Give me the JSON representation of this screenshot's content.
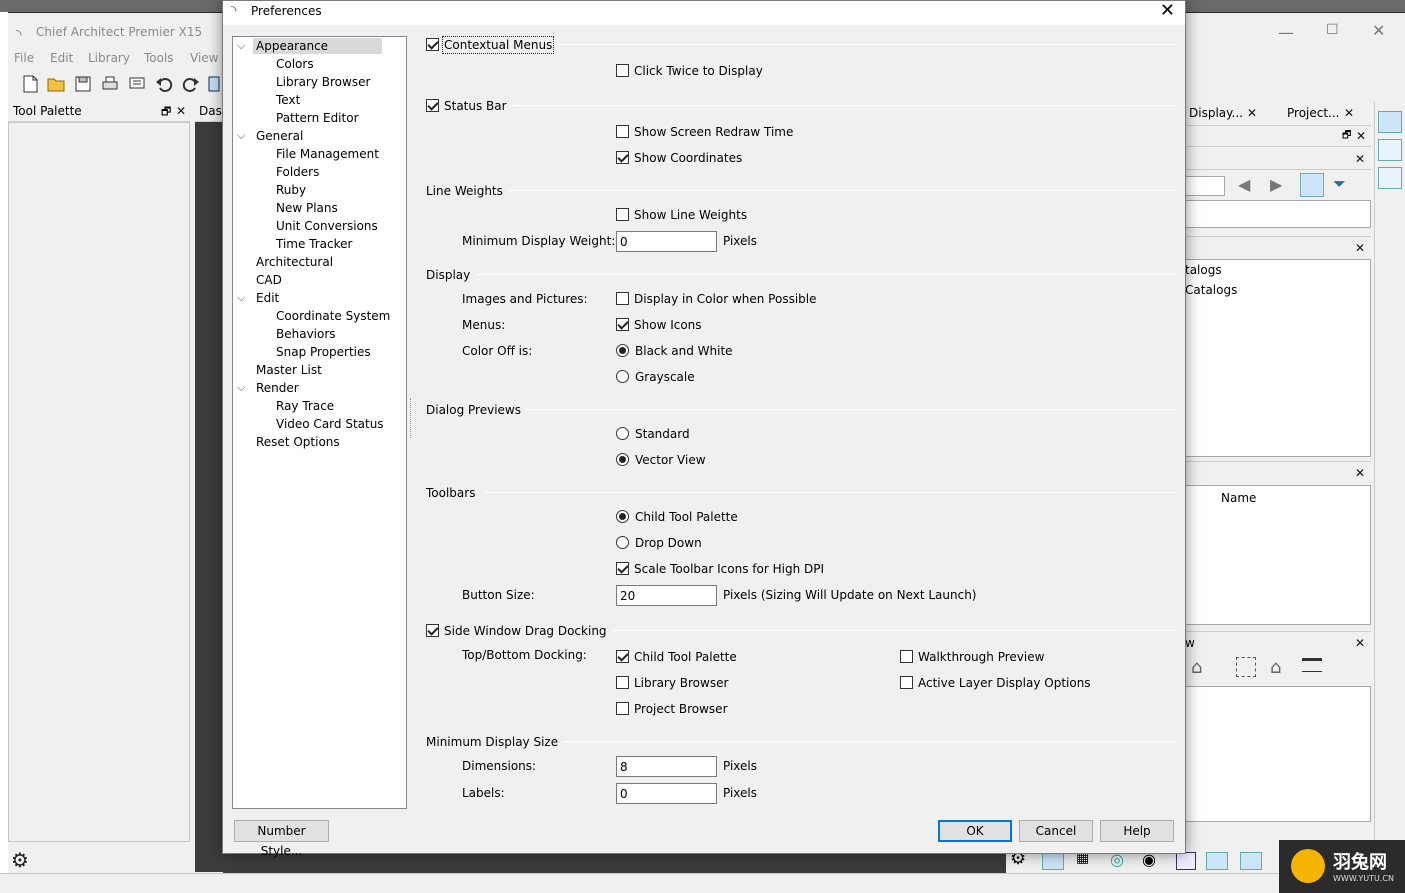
{
  "app": {
    "title": "Chief Architect Premier X15",
    "menu": [
      "File",
      "Edit",
      "Library",
      "Tools",
      "View"
    ],
    "tool_palette_title": "Tool Palette",
    "center_tab": "Das",
    "right_tabs": [
      "Display...",
      "Project..."
    ],
    "catalog_lines": [
      "talogs",
      "Catalogs"
    ],
    "name_column": "Name",
    "partial_label": "w"
  },
  "dialog": {
    "title": "Preferences",
    "tree": [
      {
        "label": "Appearance",
        "level": 0,
        "expanded": true,
        "selected": true
      },
      {
        "label": "Colors",
        "level": 1
      },
      {
        "label": "Library Browser",
        "level": 1
      },
      {
        "label": "Text",
        "level": 1
      },
      {
        "label": "Pattern Editor",
        "level": 1
      },
      {
        "label": "General",
        "level": 0,
        "expanded": true
      },
      {
        "label": "File Management",
        "level": 1
      },
      {
        "label": "Folders",
        "level": 1
      },
      {
        "label": "Ruby",
        "level": 1
      },
      {
        "label": "New Plans",
        "level": 1
      },
      {
        "label": "Unit Conversions",
        "level": 1
      },
      {
        "label": "Time Tracker",
        "level": 1
      },
      {
        "label": "Architectural",
        "level": 0
      },
      {
        "label": "CAD",
        "level": 0
      },
      {
        "label": "Edit",
        "level": 0,
        "expanded": true
      },
      {
        "label": "Coordinate System",
        "level": 1
      },
      {
        "label": "Behaviors",
        "level": 1
      },
      {
        "label": "Snap Properties",
        "level": 1
      },
      {
        "label": "Master List",
        "level": 0
      },
      {
        "label": "Render",
        "level": 0,
        "expanded": true
      },
      {
        "label": "Ray Trace",
        "level": 1
      },
      {
        "label": "Video Card Status",
        "level": 1
      },
      {
        "label": "Reset Options",
        "level": 0
      }
    ],
    "contextual_menus": {
      "label": "Contextual Menus",
      "checked": true
    },
    "click_twice": {
      "label": "Click Twice to Display",
      "checked": false
    },
    "status_bar": {
      "label": "Status Bar",
      "checked": true
    },
    "show_redraw": {
      "label": "Show Screen Redraw Time",
      "checked": false
    },
    "show_coords": {
      "label": "Show Coordinates",
      "checked": true
    },
    "line_weights": {
      "title": "Line Weights",
      "show": {
        "label": "Show Line Weights",
        "checked": false
      },
      "min_label": "Minimum Display Weight:",
      "min_value": "0",
      "unit": "Pixels"
    },
    "display": {
      "title": "Display",
      "images_label": "Images and Pictures:",
      "images_cb": {
        "label": "Display in Color when Possible",
        "checked": false
      },
      "menus_label": "Menus:",
      "menus_cb": {
        "label": "Show Icons",
        "checked": true
      },
      "color_off_label": "Color Off is:",
      "bw": {
        "label": "Black and White",
        "checked": true
      },
      "gray": {
        "label": "Grayscale",
        "checked": false
      }
    },
    "dialog_previews": {
      "title": "Dialog Previews",
      "standard": {
        "label": "Standard",
        "checked": false
      },
      "vector": {
        "label": "Vector View",
        "checked": true
      }
    },
    "toolbars": {
      "title": "Toolbars",
      "child": {
        "label": "Child Tool Palette",
        "checked": true
      },
      "dropdown": {
        "label": "Drop Down",
        "checked": false
      },
      "scale": {
        "label": "Scale Toolbar Icons for High DPI",
        "checked": true
      },
      "button_size_label": "Button Size:",
      "button_size_value": "20",
      "button_size_note": "Pixels (Sizing Will Update on Next Launch)"
    },
    "side_docking": {
      "label": "Side Window Drag Docking",
      "checked": true,
      "top_bottom_label": "Top/Bottom Docking:",
      "child": {
        "label": "Child Tool Palette",
        "checked": true
      },
      "library": {
        "label": "Library Browser",
        "checked": false
      },
      "project": {
        "label": "Project Browser",
        "checked": false
      },
      "walkthrough": {
        "label": "Walkthrough Preview",
        "checked": false
      },
      "active_layer": {
        "label": "Active Layer Display Options",
        "checked": false
      }
    },
    "min_display_size": {
      "title": "Minimum Display Size",
      "dimensions_label": "Dimensions:",
      "dimensions_value": "8",
      "labels_label": "Labels:",
      "labels_value": "0",
      "unit": "Pixels"
    },
    "buttons": {
      "number_style": "Number Style...",
      "ok": "OK",
      "cancel": "Cancel",
      "help": "Help"
    }
  },
  "watermark": {
    "text": "羽兔网",
    "sub": "WWW.YUTU.CN"
  }
}
